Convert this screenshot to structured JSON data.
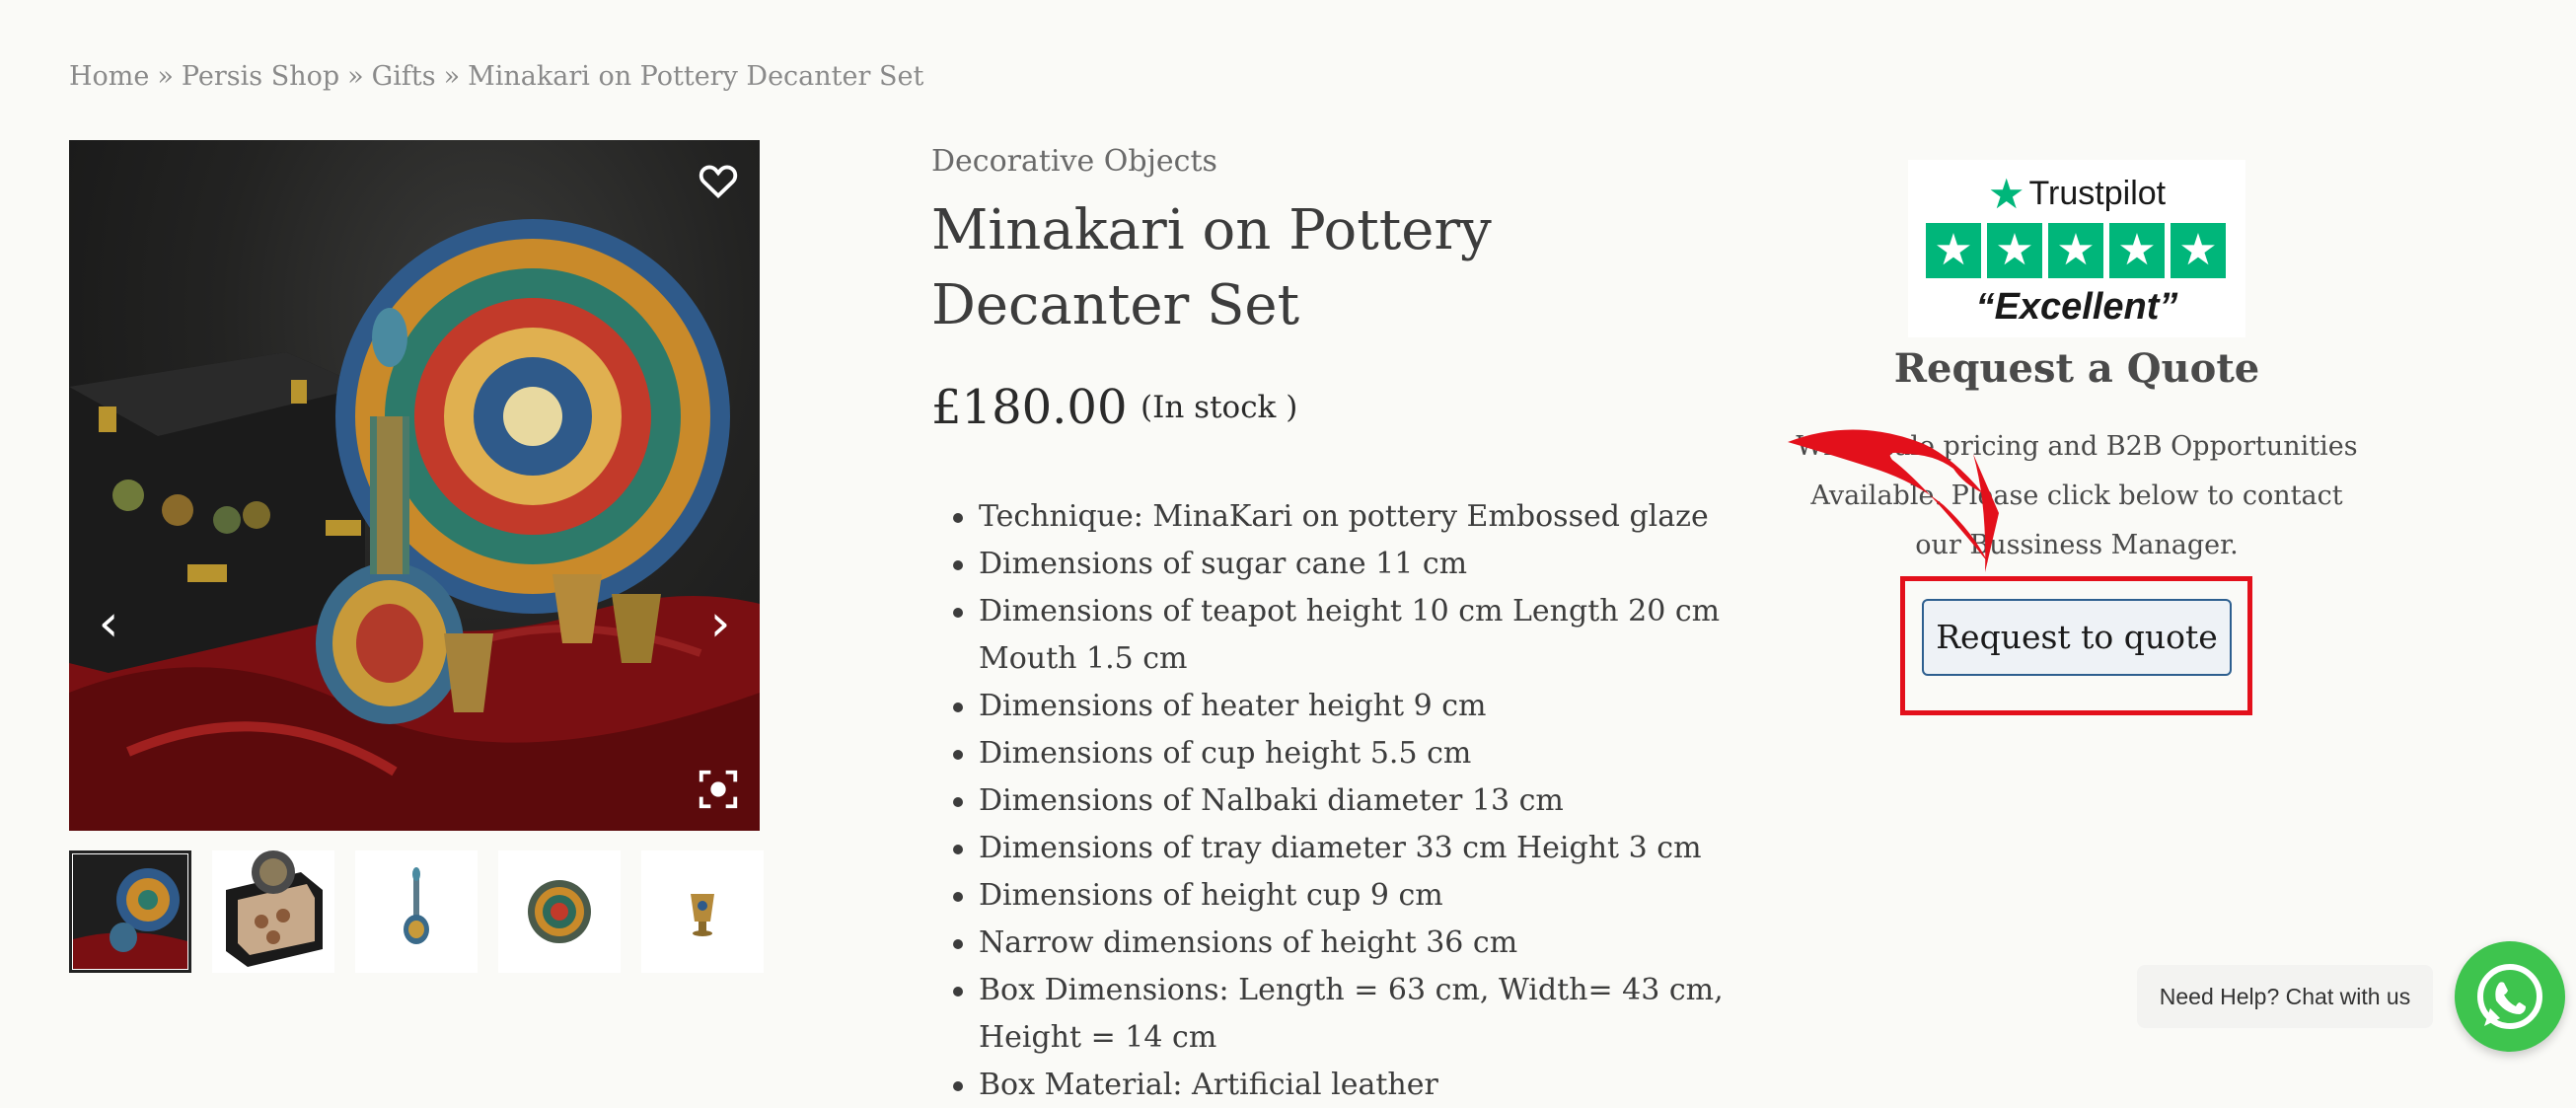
{
  "breadcrumb": {
    "items": [
      "Home",
      "Persis Shop",
      "Gifts",
      "Minakari on Pottery Decanter Set"
    ],
    "separator": "»"
  },
  "gallery": {
    "prev_icon": "chevron-left-icon",
    "next_icon": "chevron-right-icon",
    "wishlist_icon": "heart-icon",
    "zoom_icon": "fullscreen-icon",
    "thumbnail_count": 5
  },
  "product": {
    "category": "Decorative Objects",
    "title": "Minakari on Pottery Decanter Set",
    "price": "£180.00",
    "stock": "(In stock )",
    "specs": [
      "Technique: MinaKari on pottery Embossed glaze",
      "Dimensions of sugar cane 11 cm",
      "Dimensions of teapot height 10 cm Length 20 cm Mouth 1.5 cm",
      "Dimensions of heater height 9 cm",
      "Dimensions of cup height 5.5 cm",
      "Dimensions of Nalbaki diameter 13 cm",
      "Dimensions of tray diameter 33 cm Height 3 cm",
      "Dimensions of height cup 9 cm",
      "Narrow dimensions of height 36 cm",
      "Box Dimensions: Length = 63 cm, Width= 43 cm, Height = 14 cm",
      "Box Material: Artificial leather"
    ]
  },
  "quote_panel": {
    "trustpilot": {
      "brand": "Trustpilot",
      "rating_label": "“Excellent”",
      "stars": 5,
      "color": "#00b67a"
    },
    "title": "Request a Quote",
    "description": "Wholesale pricing and B2B Opportunities Available. Please click below to contact our Bussiness Manager.",
    "button_label": "Request to quote",
    "highlight_color": "#e3101b"
  },
  "chat": {
    "label": "Need Help? Chat with us",
    "icon": "whatsapp-icon",
    "color": "#3ec44e"
  }
}
